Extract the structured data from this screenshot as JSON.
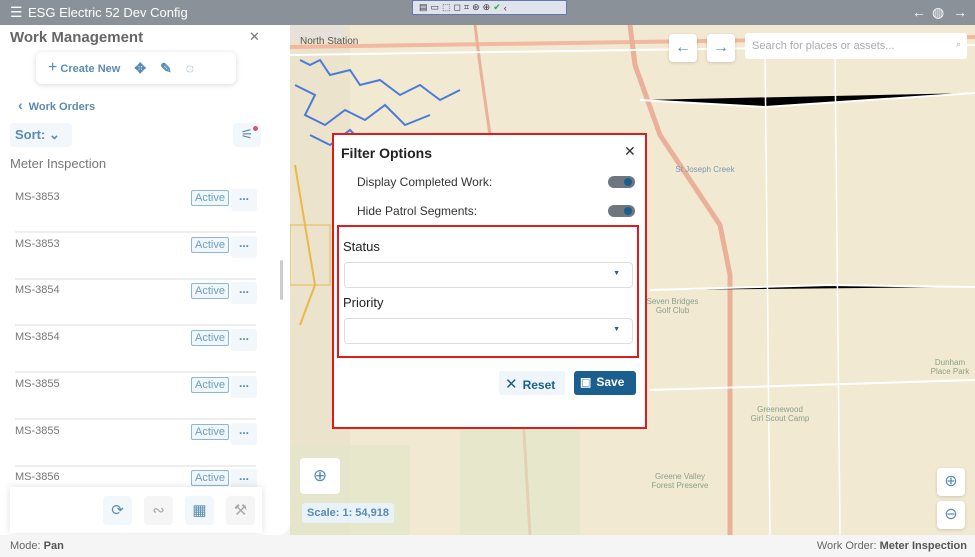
{
  "app": {
    "title": "ESG Electric 52 Dev Config",
    "menu_icon": "hamburger-icon",
    "back_icon": "arrow-left-icon",
    "globe_icon": "globe-icon",
    "forward_icon": "arrow-right-icon"
  },
  "recorder_toolbar": {
    "icons": [
      "screenshot-icon",
      "video-icon",
      "pointer-icon",
      "window-icon",
      "region-icon",
      "settings-icon",
      "accessibility-icon",
      "check-icon",
      "collapse-icon"
    ]
  },
  "panel": {
    "title": "Work Management",
    "toolbar": {
      "create_new": "Create New"
    },
    "back_label": "Work Orders",
    "sort_label": "Sort:",
    "category": "Meter Inspection",
    "items": [
      {
        "id": "MS-3853",
        "status": "Active"
      },
      {
        "id": "MS-3853",
        "status": "Active"
      },
      {
        "id": "MS-3854",
        "status": "Active"
      },
      {
        "id": "MS-3854",
        "status": "Active"
      },
      {
        "id": "MS-3855",
        "status": "Active"
      },
      {
        "id": "MS-3855",
        "status": "Active"
      },
      {
        "id": "MS-3856",
        "status": "Active"
      }
    ],
    "more_label": "..."
  },
  "map": {
    "search_placeholder": "Search for places or assets...",
    "scale": "Scale: 1: 54,918",
    "labels": {
      "north_station": "North Station",
      "seven_bridges": "Seven Bridges Golf Club",
      "greenewood": "Greenewood Girl Scout Camp",
      "dunham": "Dunham Place Park",
      "greene_valley": "Greene Valley Forest Preserve",
      "st_joseph": "St Joseph Creek"
    }
  },
  "filter_dialog": {
    "title": "Filter Options",
    "display_completed_label": "Display Completed Work:",
    "display_completed_on": true,
    "hide_patrol_label": "Hide Patrol Segments:",
    "hide_patrol_on": true,
    "status_label": "Status",
    "status_value": "",
    "priority_label": "Priority",
    "priority_value": "",
    "reset_label": "Reset",
    "save_label": "Save"
  },
  "status_bar": {
    "mode_label": "Mode:",
    "mode_value": "Pan",
    "work_order_label": "Work Order:",
    "work_order_value": "Meter Inspection"
  },
  "colors": {
    "accent": "#1a5f8e",
    "highlight_border": "#e01b1b",
    "topbar": "#8a9199"
  }
}
